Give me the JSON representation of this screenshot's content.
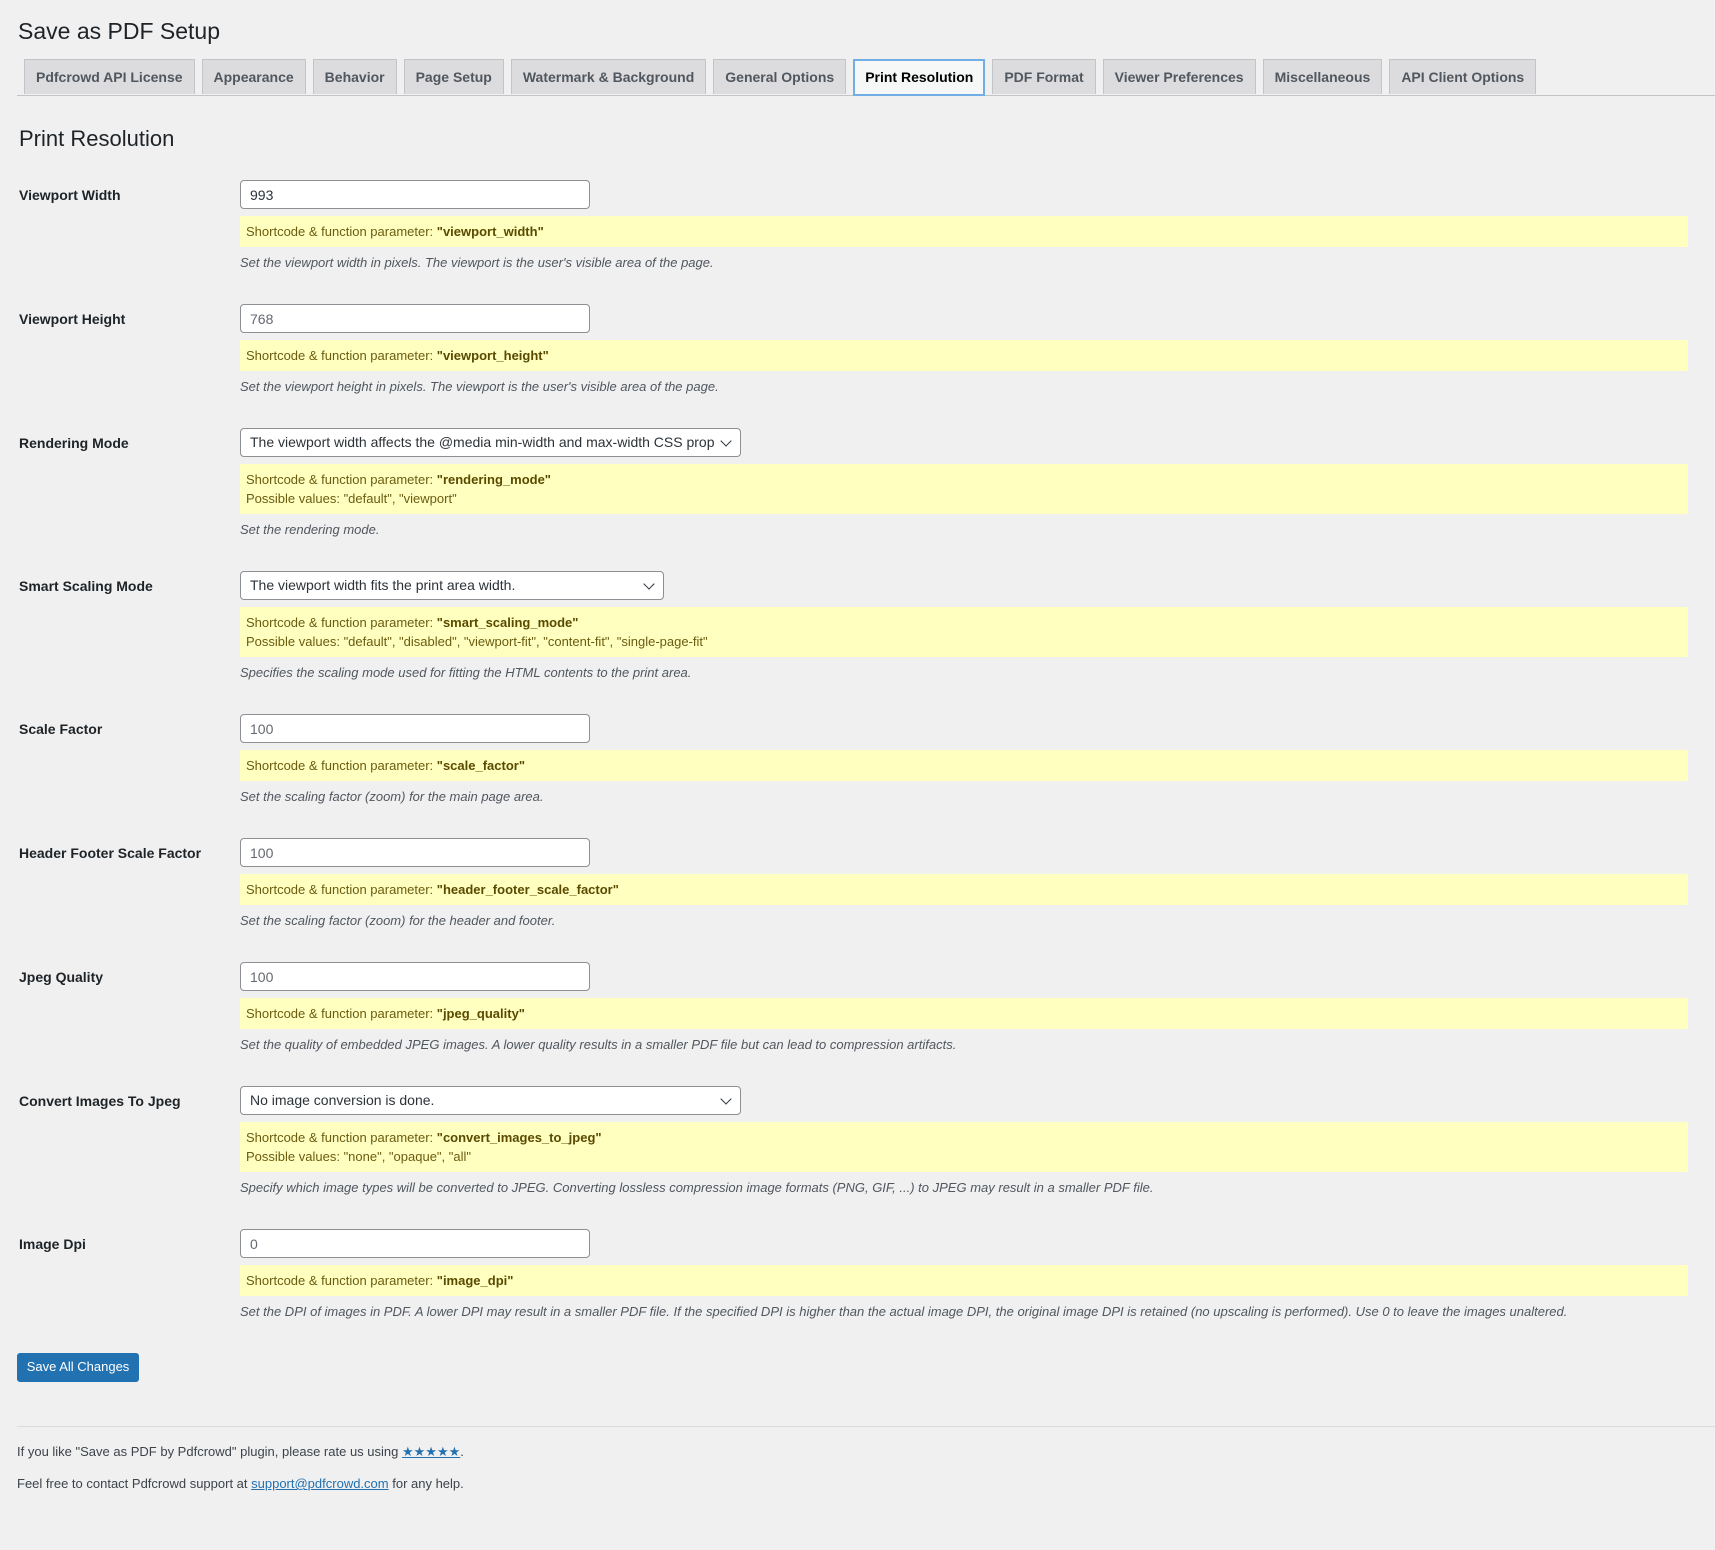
{
  "page_title": "Save as PDF Setup",
  "tabs": [
    {
      "label": "Pdfcrowd API License",
      "active": false
    },
    {
      "label": "Appearance",
      "active": false
    },
    {
      "label": "Behavior",
      "active": false
    },
    {
      "label": "Page Setup",
      "active": false
    },
    {
      "label": "Watermark & Background",
      "active": false
    },
    {
      "label": "General Options",
      "active": false
    },
    {
      "label": "Print Resolution",
      "active": true
    },
    {
      "label": "PDF Format",
      "active": false
    },
    {
      "label": "Viewer Preferences",
      "active": false
    },
    {
      "label": "Miscellaneous",
      "active": false
    },
    {
      "label": "API Client Options",
      "active": false
    }
  ],
  "section_title": "Print Resolution",
  "hint_prefix": "Shortcode & function parameter: ",
  "values_prefix": "Possible values: ",
  "fields": [
    {
      "label": "Viewport Width",
      "type": "input",
      "value": "993",
      "placeholder": false,
      "param": "\"viewport_width\"",
      "possible": "",
      "desc": "Set the viewport width in pixels. The viewport is the user's visible area of the page."
    },
    {
      "label": "Viewport Height",
      "type": "input",
      "value": "768",
      "placeholder": true,
      "param": "\"viewport_height\"",
      "possible": "",
      "desc": "Set the viewport height in pixels. The viewport is the user's visible area of the page."
    },
    {
      "label": "Rendering Mode",
      "type": "select",
      "value": "The viewport width affects the @media min-width and max-width CSS prop",
      "param": "\"rendering_mode\"",
      "possible": "\"default\", \"viewport\"",
      "desc": "Set the rendering mode."
    },
    {
      "label": "Smart Scaling Mode",
      "type": "select",
      "value": "The viewport width fits the print area width.",
      "param": "\"smart_scaling_mode\"",
      "possible": "\"default\", \"disabled\", \"viewport-fit\", \"content-fit\", \"single-page-fit\"",
      "desc": "Specifies the scaling mode used for fitting the HTML contents to the print area."
    },
    {
      "label": "Scale Factor",
      "type": "input",
      "value": "100",
      "placeholder": true,
      "param": "\"scale_factor\"",
      "possible": "",
      "desc": "Set the scaling factor (zoom) for the main page area."
    },
    {
      "label": "Header Footer Scale Factor",
      "type": "input",
      "value": "100",
      "placeholder": true,
      "param": "\"header_footer_scale_factor\"",
      "possible": "",
      "desc": "Set the scaling factor (zoom) for the header and footer."
    },
    {
      "label": "Jpeg Quality",
      "type": "input",
      "value": "100",
      "placeholder": true,
      "param": "\"jpeg_quality\"",
      "possible": "",
      "desc": "Set the quality of embedded JPEG images. A lower quality results in a smaller PDF file but can lead to compression artifacts."
    },
    {
      "label": "Convert Images To Jpeg",
      "type": "select",
      "value": "No image conversion is done.",
      "param": "\"convert_images_to_jpeg\"",
      "possible": "\"none\", \"opaque\", \"all\"",
      "desc": "Specify which image types will be converted to JPEG. Converting lossless compression image formats (PNG, GIF, ...) to JPEG may result in a smaller PDF file."
    },
    {
      "label": "Image Dpi",
      "type": "input",
      "value": "0",
      "placeholder": true,
      "param": "\"image_dpi\"",
      "possible": "",
      "desc": "Set the DPI of images in PDF. A lower DPI may result in a smaller PDF file. If the specified DPI is higher than the actual image DPI, the original image DPI is retained (no upscaling is performed). Use 0 to leave the images unaltered."
    }
  ],
  "save_label": "Save All Changes",
  "footer": {
    "rate_prefix": "If you like \"Save as PDF by Pdfcrowd\" plugin, please rate us using ",
    "rate_link": "★★★★★",
    "rate_suffix": ".",
    "contact_prefix": "Feel free to contact Pdfcrowd support at ",
    "contact_link": "support@pdfcrowd.com",
    "contact_suffix": " for any help."
  },
  "colors": {
    "accent": "#2271b1",
    "hint_bg": "#ffffc0",
    "page_bg": "#f0f0f1"
  }
}
